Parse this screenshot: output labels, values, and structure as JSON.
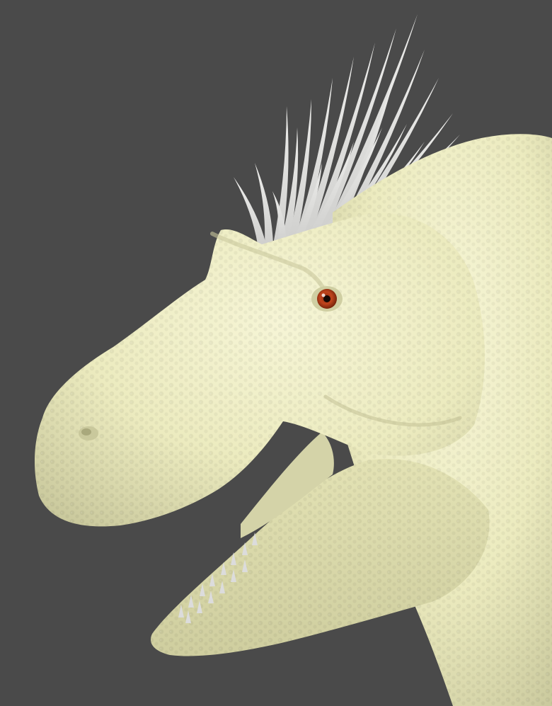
{
  "scene": {
    "subject": "dinosaur-head-sculpt",
    "colors": {
      "background": "#4a4a4a",
      "skin": "#ecebbf",
      "skin_shadow": "#b9b98e",
      "skin_highlight": "#f6f5d6",
      "crest_spikes": "#e3e3e1",
      "teeth": "#dcdcdc",
      "mouth_interior": "#d4d3a8",
      "eye_iris": "#c0441d",
      "eye_pupil": "#140804"
    }
  }
}
